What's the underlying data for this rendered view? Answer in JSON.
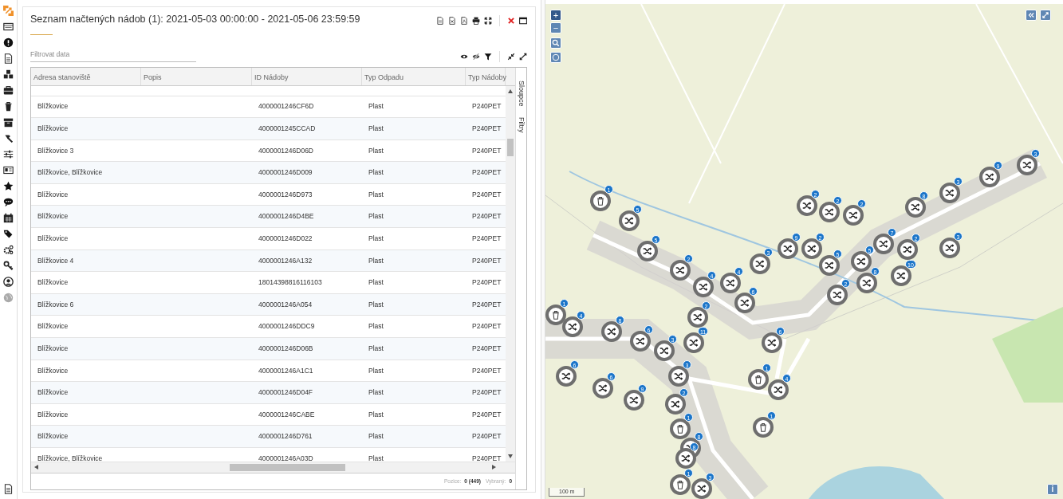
{
  "panel": {
    "title": "Seznam načtených nádob (1): 2021-05-03 00:00:00 - 2021-05-06 23:59:59",
    "filter": {
      "placeholder": "Filtrovat data"
    }
  },
  "table": {
    "columns": [
      "Adresa stanoviště",
      "Popis",
      "ID Nádoby",
      "Typ Odpadu",
      "Typ Nádoby"
    ],
    "rows": [
      [
        "Blížkovice",
        "",
        "4000001246CF6D",
        "Plast",
        "P240PET"
      ],
      [
        "Blížkovice",
        "",
        "4000001245CCAD",
        "Plast",
        "P240PET"
      ],
      [
        "Blížkovice 3",
        "",
        "4000001246D06D",
        "Plast",
        "P240PET"
      ],
      [
        "Blížkovice, Blížkovice",
        "",
        "4000001246D009",
        "Plast",
        "P240PET"
      ],
      [
        "Blížkovice",
        "",
        "4000001246D973",
        "Plast",
        "P240PET"
      ],
      [
        "Blížkovice",
        "",
        "4000001246D4BE",
        "Plast",
        "P240PET"
      ],
      [
        "Blížkovice",
        "",
        "4000001246D022",
        "Plast",
        "P240PET"
      ],
      [
        "Blížkovice 4",
        "",
        "4000001246A132",
        "Plast",
        "P240PET"
      ],
      [
        "Blížkovice",
        "",
        "18014398816116103",
        "Plast",
        "P240PET"
      ],
      [
        "Blížkovice 6",
        "",
        "4000001246A054",
        "Plast",
        "P240PET"
      ],
      [
        "Blížkovice",
        "",
        "4000001246DDC9",
        "Plast",
        "P240PET"
      ],
      [
        "Blížkovice",
        "",
        "4000001246D06B",
        "Plast",
        "P240PET"
      ],
      [
        "Blížkovice",
        "",
        "4000001246A1C1",
        "Plast",
        "P240PET"
      ],
      [
        "Blížkovice",
        "",
        "4000001246D04F",
        "Plast",
        "P240PET"
      ],
      [
        "Blížkovice",
        "",
        "4000001246CABE",
        "Plast",
        "P240PET"
      ],
      [
        "Blížkovice",
        "",
        "4000001246D761",
        "Plast",
        "P240PET"
      ],
      [
        "Blížkovice, Blížkovice",
        "",
        "4000001246A03D",
        "Plast",
        "P240PET"
      ]
    ],
    "side_tabs": [
      "Sloupce",
      "Filtry"
    ],
    "footer": {
      "position_label": "Pozice:",
      "position_value": "0 (449)",
      "selected_label": "Vybraný:",
      "selected_value": "0"
    }
  },
  "map": {
    "zoom_in": "+",
    "zoom_out": "−",
    "scale": "100 m",
    "info": "i",
    "markers": [
      {
        "kind": "bin",
        "count": "1"
      },
      {
        "kind": "shuffle",
        "count": "5"
      },
      {
        "kind": "shuffle",
        "count": "5"
      },
      {
        "kind": "shuffle",
        "count": "2"
      },
      {
        "kind": "shuffle",
        "count": "4"
      },
      {
        "kind": "shuffle",
        "count": "4"
      },
      {
        "kind": "shuffle",
        "count": "3"
      },
      {
        "kind": "shuffle",
        "count": "6"
      },
      {
        "kind": "shuffle",
        "count": "2"
      },
      {
        "kind": "shuffle",
        "count": "11"
      },
      {
        "kind": "shuffle",
        "count": "3"
      },
      {
        "kind": "shuffle",
        "count": "6"
      },
      {
        "kind": "shuffle",
        "count": "8"
      },
      {
        "kind": "bin",
        "count": "1"
      },
      {
        "kind": "shuffle",
        "count": "4"
      },
      {
        "kind": "shuffle",
        "count": "6"
      },
      {
        "kind": "shuffle",
        "count": "6"
      },
      {
        "kind": "shuffle",
        "count": "9"
      },
      {
        "kind": "shuffle",
        "count": "2"
      },
      {
        "kind": "shuffle",
        "count": "3"
      },
      {
        "kind": "shuffle",
        "count": "6"
      },
      {
        "kind": "bin",
        "count": "1"
      },
      {
        "kind": "shuffle",
        "count": "4"
      },
      {
        "kind": "bin",
        "count": "1"
      },
      {
        "kind": "bin",
        "count": "1"
      },
      {
        "kind": "shuffle",
        "count": "8"
      },
      {
        "kind": "shuffle",
        "count": "8"
      },
      {
        "kind": "bin",
        "count": "1"
      },
      {
        "kind": "shuffle",
        "count": "3"
      },
      {
        "kind": "shuffle",
        "count": "2"
      },
      {
        "kind": "shuffle",
        "count": "2"
      },
      {
        "kind": "shuffle",
        "count": "2"
      },
      {
        "kind": "shuffle",
        "count": "9"
      },
      {
        "kind": "shuffle",
        "count": "2"
      },
      {
        "kind": "shuffle",
        "count": "5"
      },
      {
        "kind": "shuffle",
        "count": "5"
      },
      {
        "kind": "shuffle",
        "count": "7"
      },
      {
        "kind": "shuffle",
        "count": "2"
      },
      {
        "kind": "shuffle",
        "count": "10"
      },
      {
        "kind": "shuffle",
        "count": "8"
      },
      {
        "kind": "shuffle",
        "count": "2"
      },
      {
        "kind": "shuffle",
        "count": "8"
      },
      {
        "kind": "shuffle",
        "count": "3"
      },
      {
        "kind": "shuffle",
        "count": "9"
      },
      {
        "kind": "shuffle",
        "count": "3"
      },
      {
        "kind": "shuffle",
        "count": "3"
      }
    ]
  }
}
